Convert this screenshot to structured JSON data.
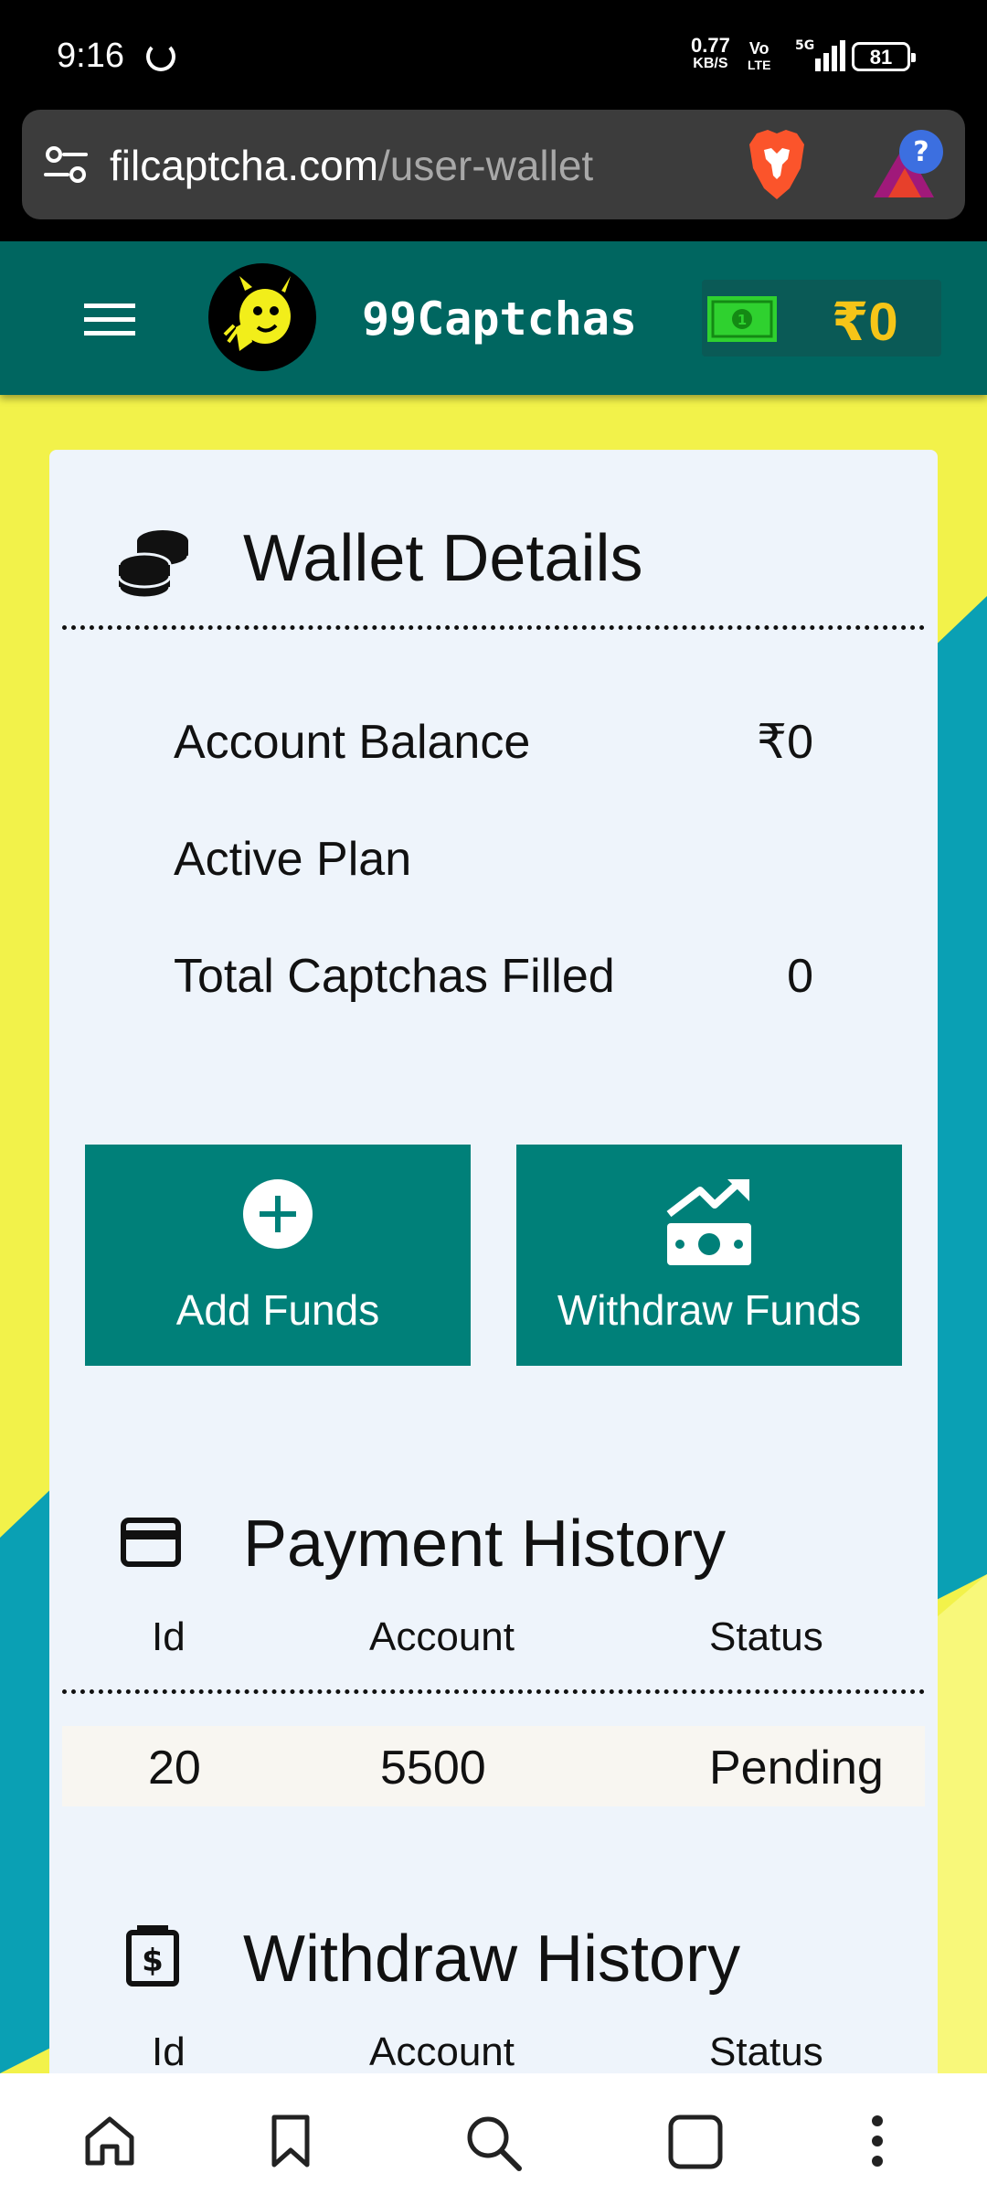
{
  "status_bar": {
    "time": "9:16",
    "net_speed_value": "0.77",
    "net_speed_unit": "KB/S",
    "volte_top": "Vo",
    "volte_bottom": "LTE",
    "network": "5G",
    "battery": "81"
  },
  "browser": {
    "url_domain": "filcaptcha.com",
    "url_path": "/user-wallet"
  },
  "header": {
    "brand": "99Captchas",
    "balance": "₹0"
  },
  "wallet": {
    "title": "Wallet Details",
    "rows": [
      {
        "label": "Account Balance",
        "value": "₹0"
      },
      {
        "label": "Active Plan",
        "value": ""
      },
      {
        "label": "Total Captchas Filled",
        "value": "0"
      }
    ]
  },
  "actions": {
    "add_funds": "Add Funds",
    "withdraw_funds": "Withdraw Funds"
  },
  "payment_history": {
    "title": "Payment History",
    "columns": [
      "Id",
      "Account",
      "Status"
    ],
    "rows": [
      {
        "id": "20",
        "account": "5500",
        "status": "Pending"
      }
    ]
  },
  "withdraw_history": {
    "title": "Withdraw History",
    "columns": [
      "Id",
      "Account",
      "Status"
    ]
  },
  "colors": {
    "header": "#006660",
    "button": "#008079",
    "balance_accent": "#f5c518",
    "bg_yellow": "#f2f24a",
    "bg_teal": "#0aa0b4"
  }
}
